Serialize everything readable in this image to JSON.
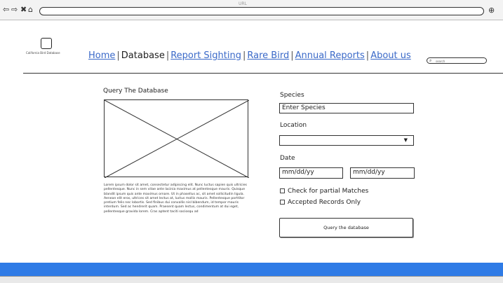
{
  "browser": {
    "tab_hint": "URL",
    "back_icon": "back-arrow-icon",
    "forward_icon": "forward-arrow-icon",
    "close_icon": "close-icon",
    "home_icon": "home-icon"
  },
  "header": {
    "logo_text": "California Bird Database",
    "nav": [
      {
        "label": "Home",
        "active": false
      },
      {
        "label": "Database",
        "active": true
      },
      {
        "label": "Report Sighting",
        "active": false
      },
      {
        "label": "Rare Bird",
        "active": false
      },
      {
        "label": "Annual Reports",
        "active": false
      },
      {
        "label": "About us",
        "active": false
      }
    ],
    "separator": "|",
    "search_placeholder": "search"
  },
  "main": {
    "query_title": "Query The Database",
    "body_text": "Lorem ipsum dolor sit amet, consectetur adipiscing elit. Nunc luctus sapien quis ultricies pellentesque. Nunc in sem vitae ante lacinia maximus at pellentesque mauris. Quisque blandit ipsum quis ante maximus ornare. Ut in phasellus ac, sit amet sollicitudin ligula. Aenean elit eros, ultrices sit amet lectus at, luctus mollis mauris. Pellentesque porttitor pretium felis nec lobortis. Sed finibus dui convallis nisl bibendum, id tempor mauris interdum. Sed ac hendrerit quam. Praesent quam lectus, condimentum at dui eget, pellentesque gravida lorem. Cras aptent taciti sociosqu ad"
  },
  "form": {
    "species_label": "Species",
    "species_value": "Enter Species",
    "location_label": "Location",
    "location_value": "",
    "date_label": "Date",
    "date_from": "mm/dd/yy",
    "date_to": "mm/dd/yy",
    "partial_label": "Check for partial Matches",
    "accepted_label": "Accepted Records Only",
    "query_button": "Query the database"
  },
  "colors": {
    "link": "#3a69c8",
    "footer": "#2f7be6"
  }
}
